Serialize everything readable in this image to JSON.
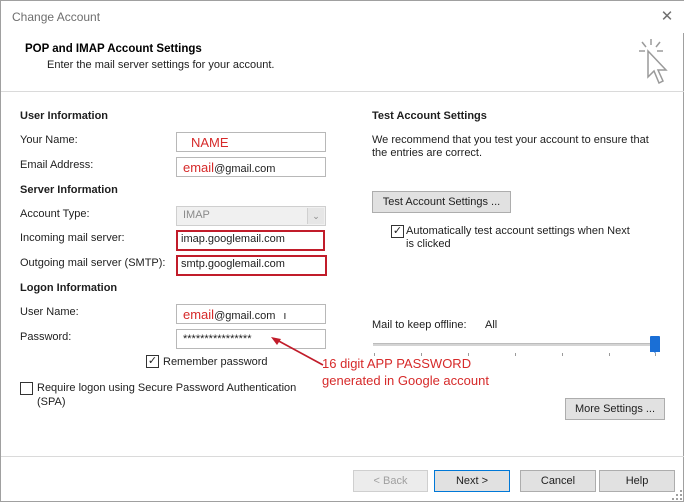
{
  "window": {
    "title": "Change Account",
    "close_glyph": "✕"
  },
  "header": {
    "title": "POP and IMAP Account Settings",
    "subtitle": "Enter the mail server settings for your account."
  },
  "user_info": {
    "section": "User Information",
    "name_label": "Your Name:",
    "name_value": "NAME",
    "email_label": "Email Address:",
    "email_red": "email",
    "email_domain": "@gmail.com"
  },
  "server_info": {
    "section": "Server Information",
    "account_type_label": "Account Type:",
    "account_type_value": "IMAP",
    "incoming_label": "Incoming mail server:",
    "incoming_value": "imap.googlemail.com",
    "outgoing_label": "Outgoing mail server (SMTP):",
    "outgoing_value": "smtp.googlemail.com"
  },
  "logon_info": {
    "section": "Logon Information",
    "username_label": "User Name:",
    "username_red": "email",
    "username_domain": "@gmail.com",
    "username_tail": "ı",
    "password_label": "Password:",
    "password_value": "****************",
    "remember_label": "Remember password",
    "remember_checked": true,
    "spa_label_1": "Require logon using Secure Password Authentication",
    "spa_label_2": "(SPA)",
    "spa_checked": false
  },
  "annotation": {
    "line1": "16 digit APP PASSWORD",
    "line2": "generated in Google account",
    "color": "#d62a2a"
  },
  "test_settings": {
    "section": "Test Account Settings",
    "desc_1": "We recommend that you test your account to ensure that",
    "desc_2": "the entries are correct.",
    "button": "Test Account Settings ...",
    "auto_label_1": "Automatically test account settings when Next",
    "auto_label_2": "is clicked",
    "auto_checked": true
  },
  "offline": {
    "label": "Mail to keep offline:",
    "value": "All",
    "slider_position": 1.0
  },
  "buttons": {
    "more_settings": "More Settings ...",
    "back": "< Back",
    "next": "Next >",
    "cancel": "Cancel",
    "help": "Help"
  },
  "colors": {
    "accent": "#1a6fd6",
    "highlight_border": "#c11c2a"
  },
  "icons": {
    "wizard": "cursor-sparkle-icon"
  }
}
